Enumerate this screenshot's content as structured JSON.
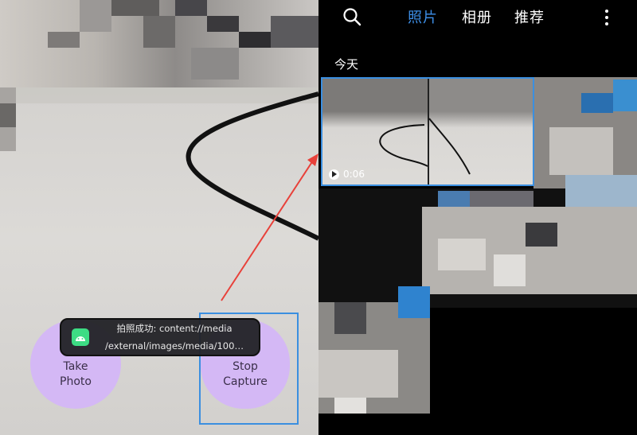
{
  "camera": {
    "take_button": "Take\nPhoto",
    "stop_button": "Stop\nCapture",
    "toast": {
      "line1": "拍照成功: content://media",
      "line2": "/external/images/media/100…"
    }
  },
  "gallery": {
    "tabs": [
      {
        "label": "照片",
        "active": true
      },
      {
        "label": "相册",
        "active": false
      },
      {
        "label": "推荐",
        "active": false
      }
    ],
    "section_title": "今天",
    "video_duration": "0:06"
  },
  "colors": {
    "accent_blue": "#3d8fe8",
    "button_purple": "#d4b8f5",
    "highlight": "#3b8fe0",
    "arrow": "#e8413a"
  }
}
